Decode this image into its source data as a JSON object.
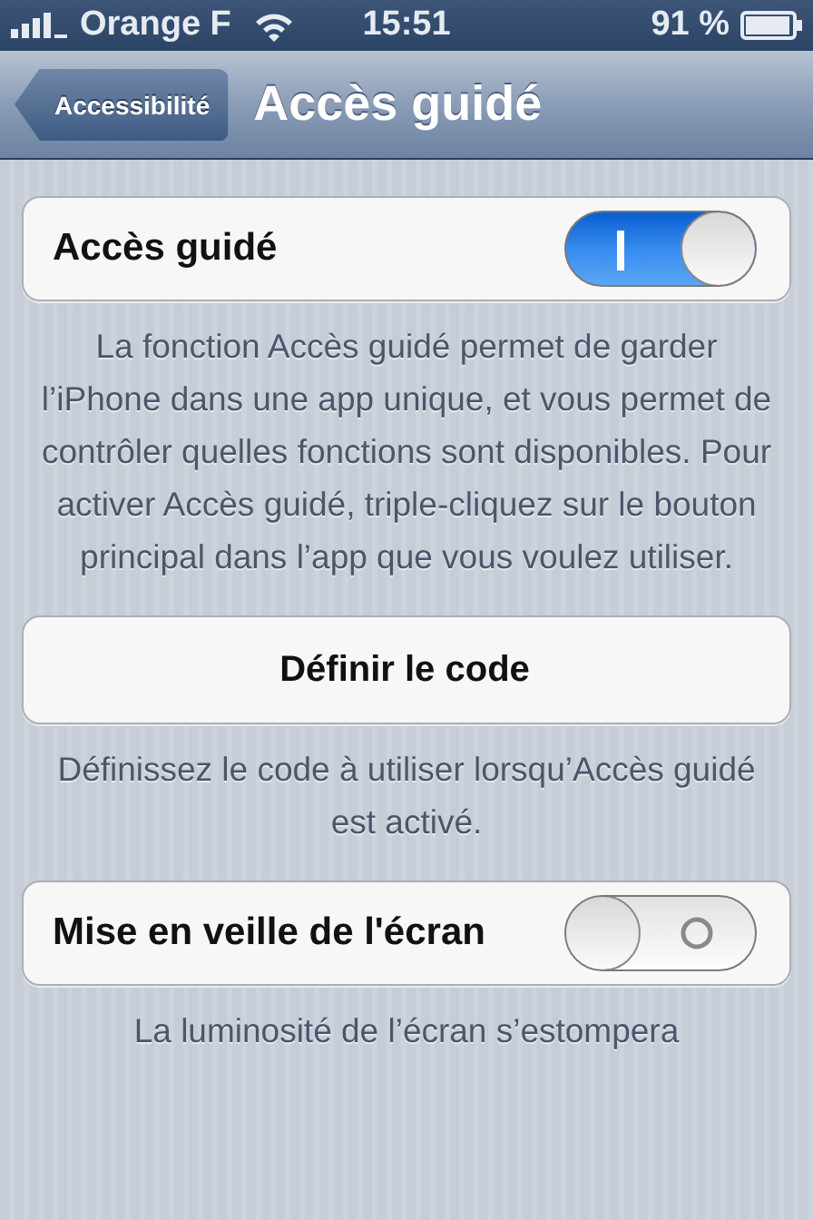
{
  "status_bar": {
    "carrier": "Orange F",
    "time": "15:51",
    "battery": "91 %"
  },
  "nav_bar": {
    "back_button": "Accessibilité",
    "title": "Accès guidé"
  },
  "sections": [
    {
      "kind": "switch",
      "label": "Accès guidé",
      "on": true,
      "footer": "La fonction Accès guidé permet de garder l’iPhone dans une app unique, et vous permet de contrôler quelles fonctions sont disponibles. Pour activer Accès guidé, triple-cliquez sur le bouton principal dans l’app que vous voulez utiliser."
    },
    {
      "kind": "button",
      "label": "Définir le code",
      "footer": "Définissez le code à utiliser lorsqu’Accès guidé est activé."
    },
    {
      "kind": "switch",
      "label": "Mise en veille de l'écran",
      "on": false,
      "footer": "La luminosité de l’écran s’estompera"
    }
  ]
}
